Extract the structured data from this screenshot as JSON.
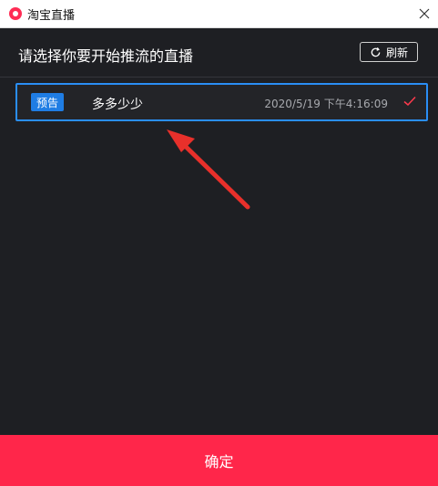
{
  "window": {
    "title": "淘宝直播",
    "icon": "taobao-live-icon"
  },
  "header": {
    "title": "请选择你要开始推流的直播",
    "refresh_label": "刷新"
  },
  "list": {
    "items": [
      {
        "badge": "预告",
        "name": "多多少少",
        "time": "2020/5/19 下午4:16:09",
        "selected": true
      }
    ]
  },
  "footer": {
    "confirm_label": "确定"
  },
  "colors": {
    "accent": "#ff264a",
    "selection_border": "#2a8ef5",
    "badge_bg": "#1f7de4",
    "annotation_arrow": "#e8302b"
  }
}
